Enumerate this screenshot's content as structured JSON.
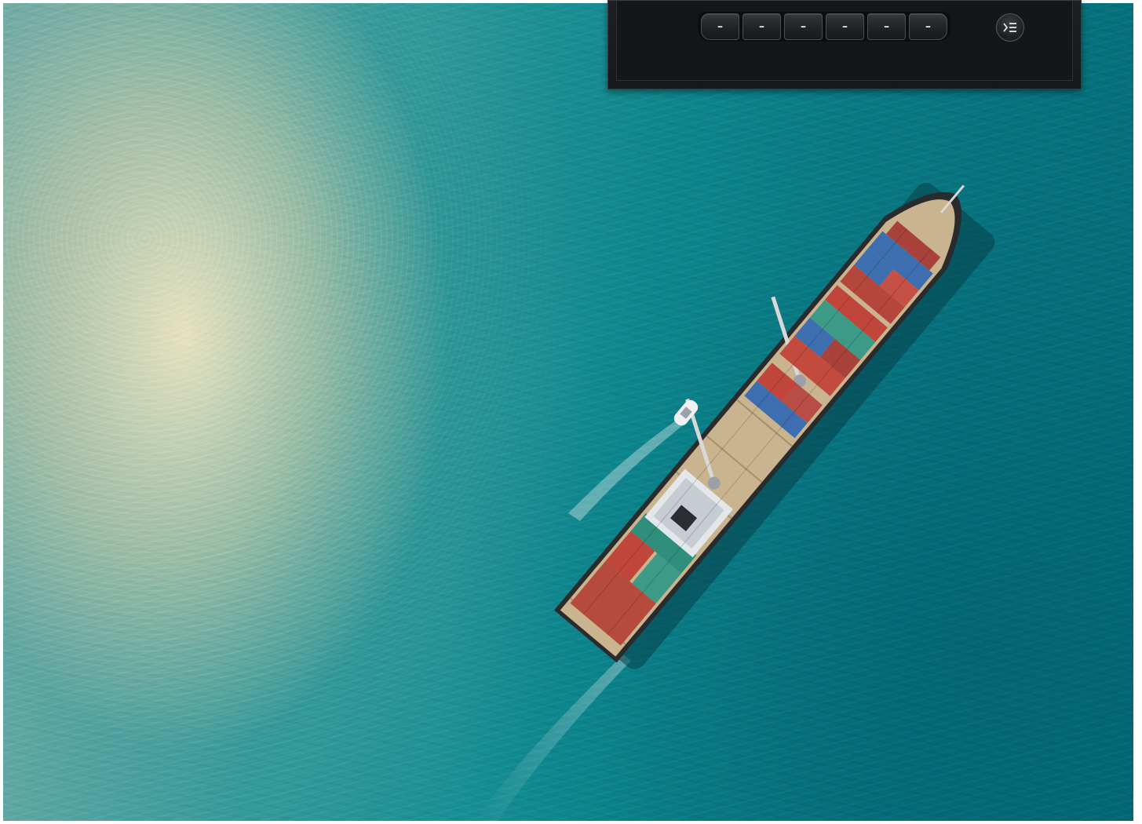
{
  "photo": {
    "subject": "aerial-cargo-ship-at-sea",
    "colors": {
      "sea_light": "#d9d2b5",
      "sea_mid": "#2f9a9a",
      "sea_deep": "#066c78",
      "hull_deck": "#c9b48f",
      "container_red": "#c0463b",
      "container_blue": "#3d6fb0",
      "container_teal": "#3c9a86"
    }
  },
  "control_panel": {
    "softkeys": [
      {
        "label": "–"
      },
      {
        "label": "–"
      },
      {
        "label": "–"
      },
      {
        "label": "–"
      },
      {
        "label": "–"
      },
      {
        "label": "–"
      }
    ],
    "menu_button": {
      "icon": "menu-list-icon"
    },
    "colors": {
      "panel": "#16181a",
      "key": "#1f2124",
      "key_border": "#4a4e54",
      "label": "#e6e6e6"
    }
  }
}
